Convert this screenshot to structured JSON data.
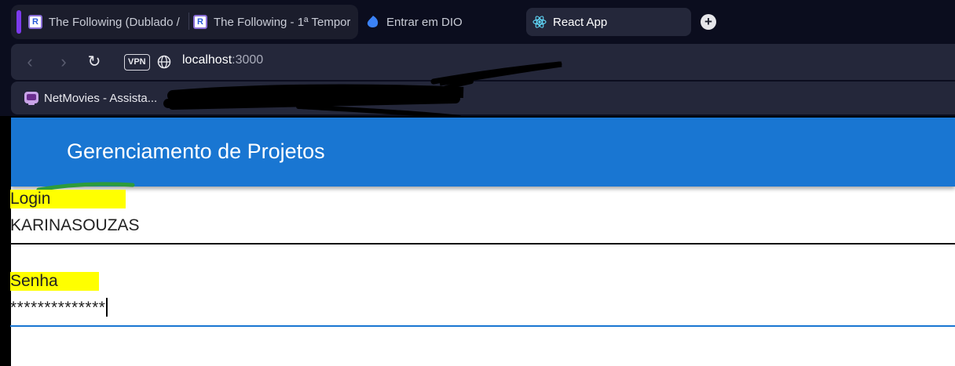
{
  "browser": {
    "tabs": [
      {
        "label": "The Following (Dublado / ",
        "icon": "rt-favicon-icon"
      },
      {
        "label": "The Following - 1ª Tempor",
        "icon": "rt-favicon-icon"
      },
      {
        "label": "Entrar em DIO",
        "icon": "dio-icon"
      },
      {
        "label": "React App",
        "icon": "react-icon",
        "active": true
      }
    ],
    "new_tab_label": "+",
    "vpn_label": "VPN",
    "url_host": "localhost",
    "url_port": ":3000",
    "bookmarks": [
      {
        "label": "NetMovies - Assista...",
        "icon": "netmovies-icon"
      }
    ]
  },
  "app": {
    "title": "Gerenciamento de Projetos",
    "login": {
      "label": "Login",
      "value": "KARINASOUZAS"
    },
    "password": {
      "label": "Senha",
      "value": "**************"
    }
  },
  "colors": {
    "appbar": "#1976d2",
    "highlight": "#ffff00",
    "chrome_bg": "#0b0d1e",
    "focus_underline": "#1976d2"
  }
}
